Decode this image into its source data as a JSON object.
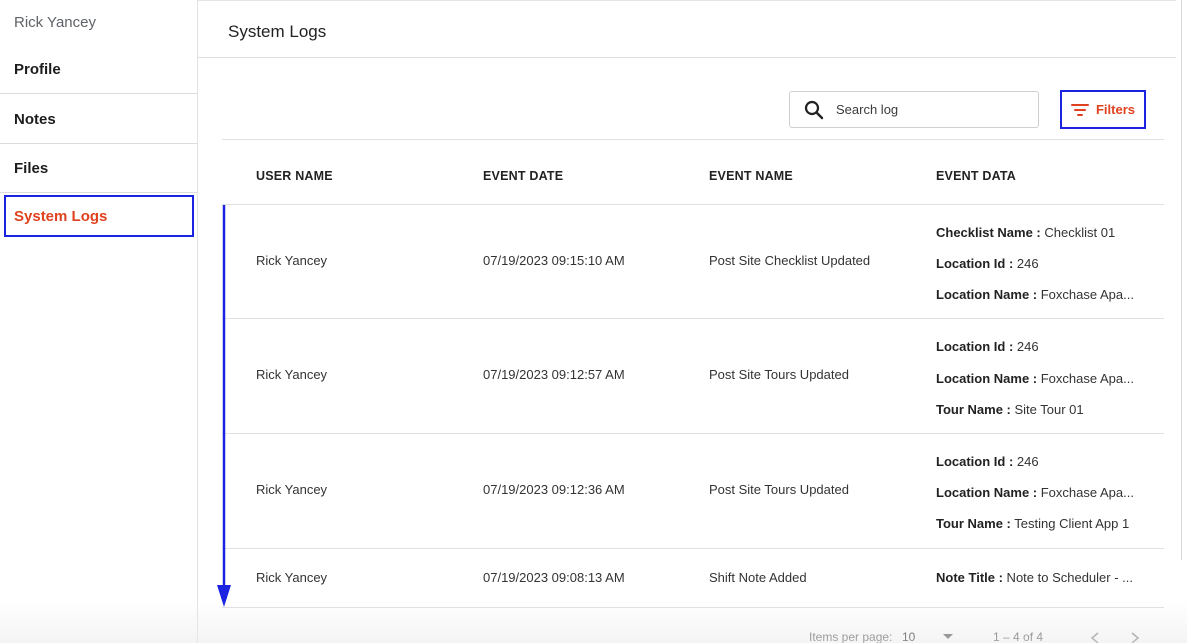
{
  "sidebar": {
    "user_name": "Rick Yancey",
    "items": [
      {
        "label": "Profile"
      },
      {
        "label": "Notes"
      },
      {
        "label": "Files"
      },
      {
        "label": "System Logs",
        "active": true
      }
    ]
  },
  "header": {
    "title": "System Logs"
  },
  "search": {
    "placeholder": "Search log",
    "value": "",
    "icon": "search-icon"
  },
  "filters": {
    "label": "Filters",
    "icon": "filter-icon",
    "color": "#e0421f"
  },
  "table": {
    "columns": [
      "USER NAME",
      "EVENT DATE",
      "EVENT NAME",
      "EVENT DATA"
    ],
    "rows": [
      {
        "user": "Rick Yancey",
        "date": "07/19/2023 09:15:10 AM",
        "event": "Post Site Checklist Updated",
        "data": [
          {
            "key": "Checklist Name :",
            "value": " Checklist 01"
          },
          {
            "key": "Location Id :",
            "value": " 246"
          },
          {
            "key": "Location Name :",
            "value": " Foxchase Apa..."
          }
        ]
      },
      {
        "user": "Rick Yancey",
        "date": "07/19/2023 09:12:57 AM",
        "event": "Post Site Tours Updated",
        "data": [
          {
            "key": "Location Id :",
            "value": " 246"
          },
          {
            "key": "Location Name :",
            "value": " Foxchase Apa..."
          },
          {
            "key": "Tour Name :",
            "value": " Site Tour 01"
          }
        ]
      },
      {
        "user": "Rick Yancey",
        "date": "07/19/2023 09:12:36 AM",
        "event": "Post Site Tours Updated",
        "data": [
          {
            "key": "Location Id :",
            "value": " 246"
          },
          {
            "key": "Location Name :",
            "value": " Foxchase Apa..."
          },
          {
            "key": "Tour Name :",
            "value": " Testing Client App 1"
          }
        ]
      },
      {
        "user": "Rick Yancey",
        "date": "07/19/2023 09:08:13 AM",
        "event": "Shift Note Added",
        "data": [
          {
            "key": "Note Title :",
            "value": " Note to Scheduler - ..."
          }
        ]
      }
    ]
  },
  "pagination": {
    "items_per_page_label": "Items per page:",
    "items_per_page": "10",
    "range": "1 – 4 of 4"
  },
  "colors": {
    "accent": "#e0421f",
    "annotation": "#1b22e0"
  }
}
